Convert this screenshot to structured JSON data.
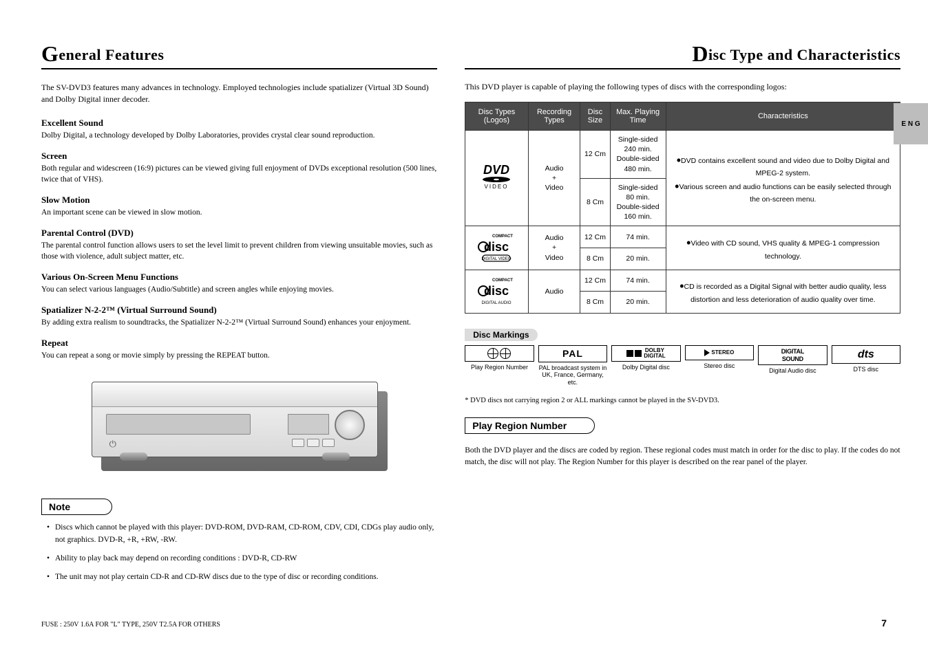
{
  "left": {
    "title_pre": "G",
    "title_rest": "eneral Features",
    "intro": "The SV-DVD3 features many advances in technology. Employed technologies include spatializer (Virtual 3D Sound) and Dolby Digital inner decoder.",
    "features": [
      {
        "title": "Excellent Sound",
        "body": "Dolby Digital, a technology developed by Dolby Laboratories, provides crystal clear sound reproduction."
      },
      {
        "title": "Screen",
        "body": "Both regular and widescreen (16:9) pictures can be viewed giving full enjoyment of DVDs exceptional resolution (500 lines, twice that of VHS)."
      },
      {
        "title": "Slow Motion",
        "body": "An important scene can be viewed in slow motion."
      },
      {
        "title": "Parental Control (DVD)",
        "body": "The parental control function allows users to set the level limit to prevent children from viewing unsuitable movies, such as those with violence, adult subject matter, etc."
      },
      {
        "title": "Various On-Screen Menu Functions",
        "body": "You can select various languages (Audio/Subtitle) and screen angles while enjoying movies."
      },
      {
        "title": "Spatializer N-2-2™ (Virtual Surround Sound)",
        "body": "By adding extra realism to soundtracks, the Spatializer N-2-2™ (Virtual Surround Sound) enhances your enjoyment."
      },
      {
        "title": "Repeat",
        "body": "You can repeat a song or movie simply by pressing the REPEAT button."
      }
    ],
    "note_header": "Note",
    "notes": [
      "Discs which cannot be played with this player: DVD-ROM, DVD-RAM, CD-ROM, CDV, CDI, CDGs play audio only, not graphics. DVD-R, +R, +RW, -RW.",
      "Ability to play back may depend on recording conditions : DVD-R, CD-RW",
      "The unit may not play certain CD-R and CD-RW discs due to the type of disc or recording conditions."
    ]
  },
  "right": {
    "title_pre": "D",
    "title_rest": "isc Type and Characteristics",
    "lead": "This DVD player is capable of playing the following types of discs with the corresponding logos:",
    "tab": "E N G",
    "table": {
      "headers": [
        "Disc Types (Logos)",
        "Recording Types",
        "Disc Size",
        "Max. Playing Time",
        "Characteristics"
      ],
      "rows": [
        {
          "logo": "dvd",
          "rec": "Audio\n+\nVideo",
          "cells": [
            {
              "size": "12 Cm",
              "time": "Single-sided 240 min.\nDouble-sided 480 min."
            },
            {
              "size": "8 Cm",
              "time": "Single-sided 80 min.\nDouble-sided 160 min."
            }
          ],
          "char_bullets": [
            "DVD contains excellent sound and video due to Dolby Digital and MPEG-2 system.",
            "Various screen and audio functions can be easily selected through the on-screen menu."
          ]
        },
        {
          "logo": "vcd",
          "rec": "Audio\n+\nVideo",
          "cells": [
            {
              "size": "12 Cm",
              "time": "74 min."
            },
            {
              "size": "8 Cm",
              "time": "20 min."
            }
          ],
          "char_bullets": [
            "Video with CD sound, VHS quality & MPEG-1 compression technology."
          ]
        },
        {
          "logo": "cd",
          "rec": "Audio",
          "cells": [
            {
              "size": "12 Cm",
              "time": "74 min."
            },
            {
              "size": "8 Cm",
              "time": "20 min."
            }
          ],
          "char_bullets": [
            "CD is recorded as a Digital Signal with better audio quality, less distortion and less deterioration of audio quality over time."
          ]
        }
      ]
    },
    "marks_title": "Disc Markings",
    "marks": [
      {
        "key": "region",
        "caption": "Play Region Number"
      },
      {
        "key": "pal",
        "label": "PAL",
        "caption": "PAL broadcast system in UK, France, Germany, etc."
      },
      {
        "key": "dolby",
        "label": "DOLBY DIGITAL",
        "caption": "Dolby Digital disc"
      },
      {
        "key": "stereo",
        "label": "STEREO",
        "caption": "Stereo disc"
      },
      {
        "key": "digital",
        "label": "DIGITAL SOUND",
        "caption": "Digital Audio disc"
      },
      {
        "key": "dts",
        "label": "dts",
        "caption": "DTS disc"
      }
    ],
    "below_marks": "* DVD discs not carrying region 2 or ALL markings cannot be played in the SV-DVD3.",
    "region_header": "Play Region Number",
    "region_text": "Both the DVD player and the discs are coded by region. These regional codes must match in order for the disc to play. If the codes do not match, the disc will not play. The Region Number for this player is described on the rear panel of the player.",
    "fuse": "FUSE : 250V 1.6A FOR \"L\" TYPE, 250V T2.5A FOR OTHERS",
    "page_num": "7"
  }
}
